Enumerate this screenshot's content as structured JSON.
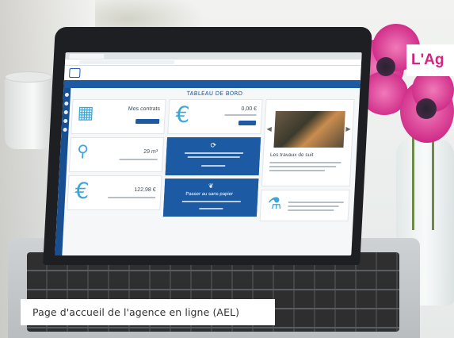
{
  "caption": {
    "text": "Page d'accueil de l'agence en ligne (AEL)"
  },
  "banner": {
    "text": "L'Ag"
  },
  "app": {
    "dashboard_title": "TABLEAU DE BORD",
    "cards": {
      "contracts": {
        "label": "Mes contrats"
      },
      "consumption": {
        "value": "29 m³"
      },
      "balance": {
        "value": "0,00 €"
      },
      "payment": {
        "value": "122,98 €"
      }
    },
    "blue_cards": {
      "paperless": {
        "label": "Passer au sans papier"
      }
    },
    "news": {
      "title": "Les travaux de suit"
    }
  },
  "colors": {
    "brand": "#1c5aa3",
    "accent": "#3aa6d9",
    "banner_text": "#d3247e"
  }
}
